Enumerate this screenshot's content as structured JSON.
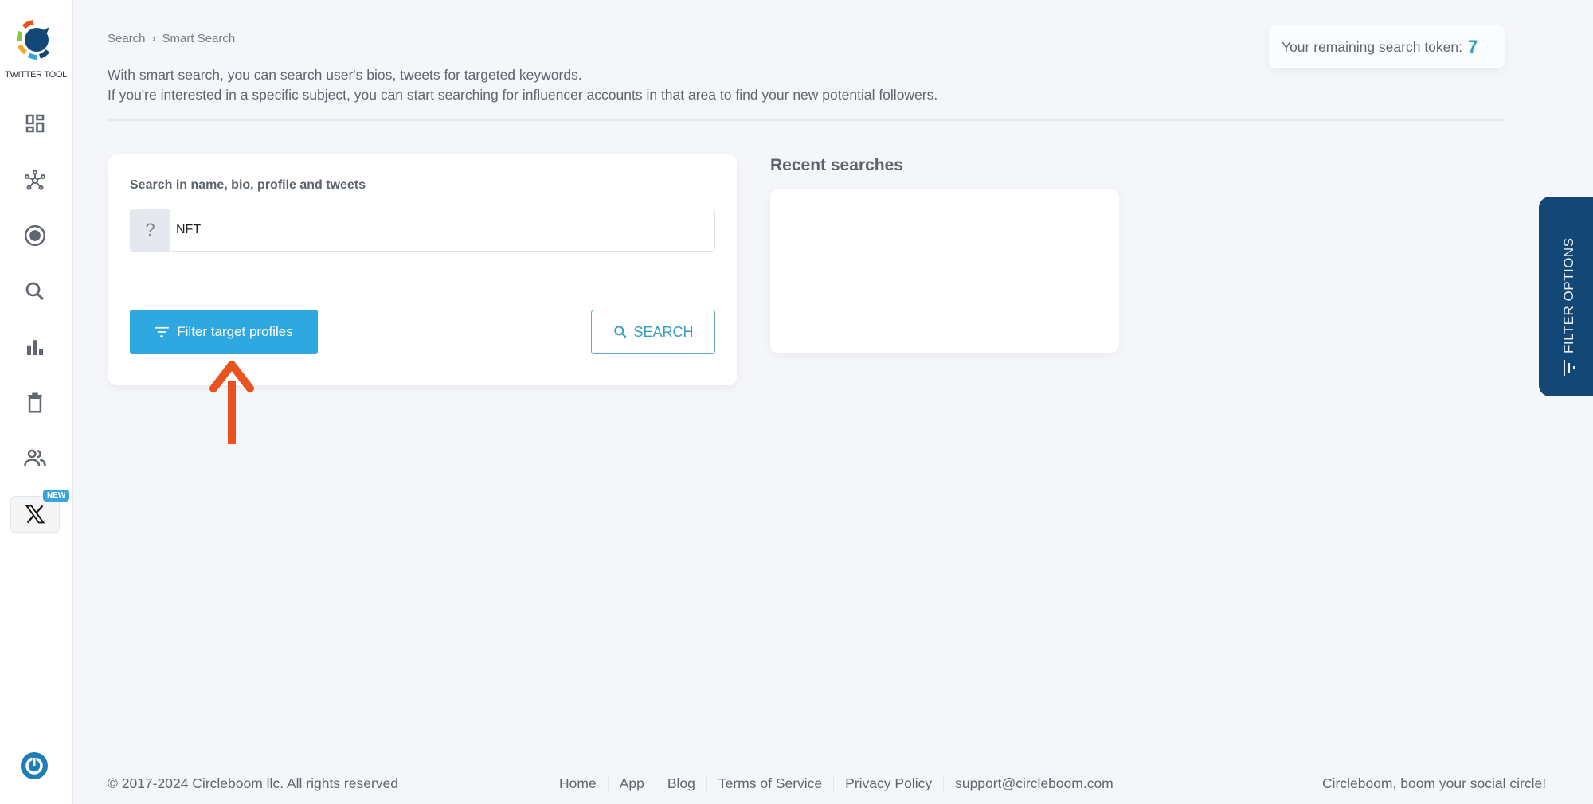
{
  "app": {
    "logo_text": "TWITTER TOOL",
    "brand_colors": {
      "primary": "#2ea8e0",
      "dark": "#134776",
      "accent": "#e8531f"
    }
  },
  "sidebar": {
    "items": [
      {
        "icon": "dashboard-icon",
        "label": "Dashboard"
      },
      {
        "icon": "network-icon",
        "label": "Network"
      },
      {
        "icon": "target-icon",
        "label": "Target"
      },
      {
        "icon": "search-icon",
        "label": "Search"
      },
      {
        "icon": "analytics-icon",
        "label": "Analytics"
      },
      {
        "icon": "trash-icon",
        "label": "Delete"
      },
      {
        "icon": "users-icon",
        "label": "Users"
      },
      {
        "icon": "x-logo-icon",
        "label": "X",
        "badge": "NEW"
      }
    ],
    "power_icon": "power-icon"
  },
  "header": {
    "breadcrumb": [
      "Search",
      "Smart Search"
    ],
    "intro_line1": "With smart search, you can search user's bios, tweets for targeted keywords.",
    "intro_line2": "If you're interested in a specific subject, you can start searching for influencer accounts in that area to find your new potential followers.",
    "token_label": "Your remaining search token:",
    "token_count": "7"
  },
  "search_card": {
    "label": "Search in name, bio, profile and tweets",
    "addon": "?",
    "input_value": "NFT",
    "filter_button": "Filter target profiles",
    "search_button": "SEARCH"
  },
  "recent": {
    "title": "Recent searches",
    "items": []
  },
  "filter_tab": {
    "label": "FILTER OPTIONS"
  },
  "footer": {
    "copyright": "© 2017-2024 Circleboom llc. All rights reserved",
    "links": [
      "Home",
      "App",
      "Blog",
      "Terms of Service",
      "Privacy Policy",
      "support@circleboom.com"
    ],
    "slogan": "Circleboom, boom your social circle!"
  }
}
